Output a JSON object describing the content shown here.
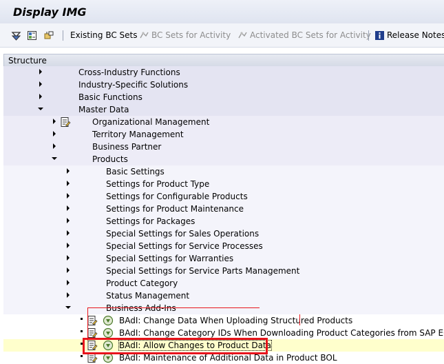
{
  "window": {
    "title": "Display IMG"
  },
  "toolbar": {
    "existing_bc_sets": "Existing BC Sets",
    "bc_sets_for_activity": "BC Sets for Activity",
    "activated_bc_sets_for_activity": "Activated BC Sets for Activity",
    "release_notes": "Release Notes"
  },
  "structure": {
    "header": "Structure",
    "items": [
      {
        "label": "Cross-Industry Functions"
      },
      {
        "label": "Industry-Specific Solutions"
      },
      {
        "label": "Basic Functions"
      },
      {
        "label": "Master Data"
      },
      {
        "label": "Organizational Management"
      },
      {
        "label": "Territory Management"
      },
      {
        "label": "Business Partner"
      },
      {
        "label": "Products"
      },
      {
        "label": "Basic Settings"
      },
      {
        "label": "Settings for Product Type"
      },
      {
        "label": "Settings for Configurable Products"
      },
      {
        "label": "Settings for Product Maintenance"
      },
      {
        "label": "Settings for Packages"
      },
      {
        "label": "Special Settings for Sales Operations"
      },
      {
        "label": "Special Settings for Service Processes"
      },
      {
        "label": "Special Settings for Warranties"
      },
      {
        "label": "Special Settings for Service Parts Management"
      },
      {
        "label": "Product Category"
      },
      {
        "label": "Status Management"
      },
      {
        "label": "Business Add-Ins"
      },
      {
        "label": "BAdI: Change Data When Uploading Structured Products"
      },
      {
        "label": "BAdI: Change Category IDs When Downloading Product Categories from SAP ECC"
      },
      {
        "label": "BAdI: Allow Changes to Product Data"
      },
      {
        "label": "BAdI: Maintenance of Additional Data in Product BOL"
      }
    ]
  },
  "colors": {
    "highlight": "#e8141b",
    "selected_row": "#ffffcc"
  }
}
